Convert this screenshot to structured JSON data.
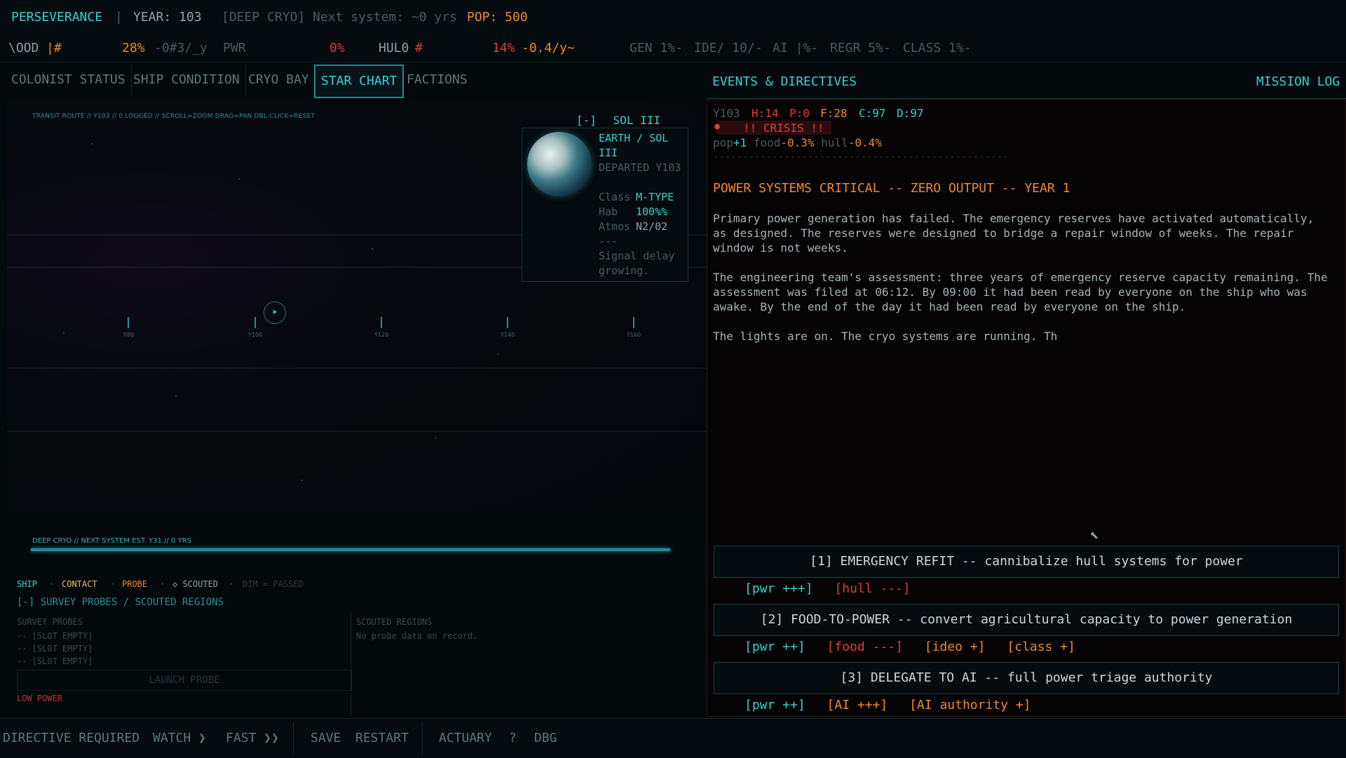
{
  "header": {
    "ship_name": "PERSEVERANCE",
    "sep": "|",
    "year_label": "YEAR: 103",
    "mode_text": "[DEEP CRYO] Next system: ~0 yrs",
    "pop_label": "POP: 500"
  },
  "stats": {
    "food_label": "\\OOD",
    "food_bar": "|#",
    "food_pct": "28%",
    "food_rate": "-0#3/_y",
    "pwr_label": "PWR",
    "pwr_pct": "0%",
    "hull_label": "HUL0",
    "hull_bar": "#",
    "hull_pct": "14%",
    "hull_rate": "-0.4/y~",
    "gen": "GEN 1%-",
    "ide": "IDE/ 10/-",
    "ai": "AI |%-",
    "regr": "REGR 5%-",
    "class": "CLASS 1%-"
  },
  "tabs": [
    {
      "label": "COLONIST STATUS"
    },
    {
      "label": "SHIP CONDITION"
    },
    {
      "label": "CRYO BAY"
    },
    {
      "label": "STAR CHART"
    },
    {
      "label": "FACTIONS"
    }
  ],
  "chart": {
    "route_header": "TRANSIT ROUTE // Y103 // 0 LOGGED // SCROLL=ZOOM DRAG=PAN DBL-CLICK=RESET",
    "ticks": [
      "Y80",
      "Y100",
      "Y120",
      "Y140",
      "Y160"
    ],
    "planet": {
      "toggle": "[-]",
      "title": "SOL III",
      "name_line1": "EARTH / SOL",
      "name_line2": "III",
      "departed": "DEPARTED Y103",
      "class_label": "Class",
      "class_value": "M-TYPE",
      "hab_label": "Hab",
      "hab_value": "100%%",
      "atmos_label": "Atmos",
      "atmos_value": "N2/02",
      "sep": "---",
      "note_line1": "Signal delay",
      "note_line2": "growing."
    },
    "cryo_status": "DEEP CRYO // NEXT SYSTEM EST. Y31 // 0 YRS"
  },
  "legend": {
    "ship": "SHIP",
    "contact": "CONTACT",
    "probe": "PROBE",
    "scouted": "◇ SCOUTED",
    "passed": "DIM = PASSED",
    "dot": "·"
  },
  "probes": {
    "header": "[-] SURVEY PROBES  /  SCOUTED REGIONS",
    "col1": "SURVEY PROBES",
    "col2": "SCOUTED REGIONS",
    "slots": [
      "--  [SLOT EMPTY]",
      "--  [SLOT EMPTY]",
      "--  [SLOT EMPTY]"
    ],
    "no_data": "No probe data on record.",
    "launch": "LAUNCH PROBE",
    "low_power": "LOW POWER"
  },
  "events": {
    "header": "EVENTS & DIRECTIVES",
    "mission_log": "MISSION LOG",
    "meta": {
      "year": "Y103",
      "h": "H:14",
      "p": "P:0",
      "f": "F:28",
      "c": "C:97",
      "d": "D:97"
    },
    "crisis": "!! CRISIS !!",
    "deltas": {
      "pop": "pop",
      "pop_v": "+1",
      "food": "food",
      "food_v": "-0.3%",
      "hull": "hull",
      "hull_v": "-0.4%"
    },
    "divider": "--------------------------------------------------",
    "title": "POWER SYSTEMS CRITICAL -- ZERO OUTPUT -- YEAR 1",
    "paragraphs": [
      "Primary power generation has failed. The emergency reserves have activated automatically, as designed. The reserves were designed to bridge a repair window of weeks. The repair window is not weeks.",
      "The engineering team's assessment: three years of emergency reserve capacity remaining. The assessment was filed at 06:12. By 09:00 it had been read by everyone on the ship who was awake. By the end of the day it had been read by everyone on the ship.",
      "The lights are on. The cryo systems are running. Th"
    ],
    "choices": [
      {
        "label": "[1]  EMERGENCY REFIT -- cannibalize hull systems for power",
        "effects": [
          {
            "t": "[pwr +++]",
            "c": "cyan"
          },
          {
            "t": "[hull ---]",
            "c": "red"
          }
        ]
      },
      {
        "label": "[2]  FOOD-TO-POWER -- convert agricultural capacity to power generation",
        "effects": [
          {
            "t": "[pwr ++]",
            "c": "cyan"
          },
          {
            "t": "[food ---]",
            "c": "red"
          },
          {
            "t": "[ideo +]",
            "c": "orange"
          },
          {
            "t": "[class +]",
            "c": "orange"
          }
        ]
      },
      {
        "label": "[3]  DELEGATE TO AI -- full power triage authority",
        "effects": [
          {
            "t": "[pwr ++]",
            "c": "cyan"
          },
          {
            "t": "[AI +++]",
            "c": "orange"
          },
          {
            "t": "[AI authority +]",
            "c": "orange"
          }
        ]
      }
    ]
  },
  "bottom": {
    "status": "DIRECTIVE REQUIRED",
    "watch": "WATCH ❯",
    "fast": "FAST ❯❯",
    "save": "SAVE",
    "restart": "RESTART",
    "actuary": "ACTUARY",
    "help": "?",
    "dbg": "DBG"
  },
  "colors": {
    "accent": "#39d0cf",
    "warning": "#f0882a",
    "danger": "#e23a3a"
  }
}
